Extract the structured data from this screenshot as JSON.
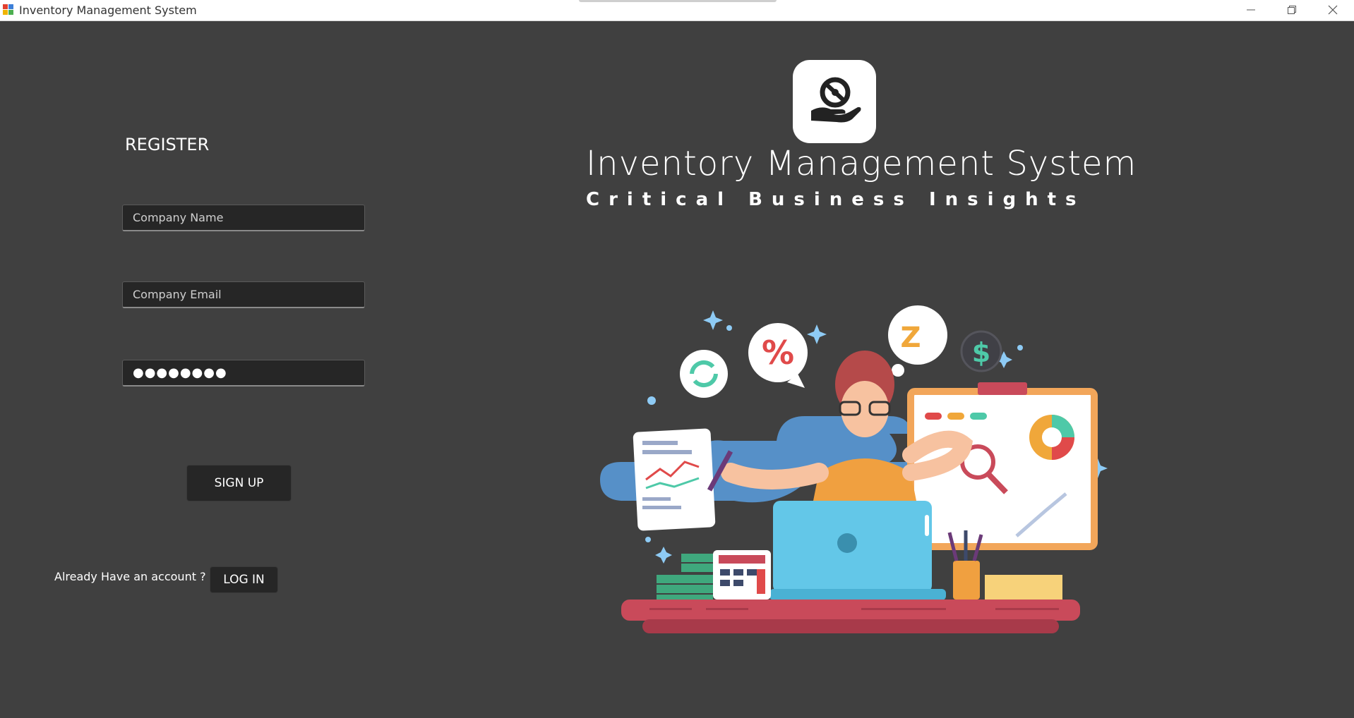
{
  "window": {
    "title": "Inventory Management System"
  },
  "register": {
    "heading": "REGISTER",
    "company_name_placeholder": "Company Name",
    "company_email_placeholder": "Company Email",
    "password_value": "●●●●●●●●",
    "signup_label": "SIGN UP",
    "already_text": "Already Have an account ?",
    "login_label": "LOG IN"
  },
  "brand": {
    "title": "Inventory Management System",
    "tagline": "Critical Business Insights"
  },
  "illustration": {
    "percent_symbol": "%",
    "dollar_symbol": "$",
    "sleep_symbol": "Z"
  },
  "icons": [
    "app-icon",
    "minimize-icon",
    "restore-icon",
    "close-icon",
    "hand-coin-logo-icon"
  ],
  "colors": {
    "background": "#404040",
    "field_bg": "#262626",
    "button_bg": "#262626",
    "text": "#ffffff"
  }
}
